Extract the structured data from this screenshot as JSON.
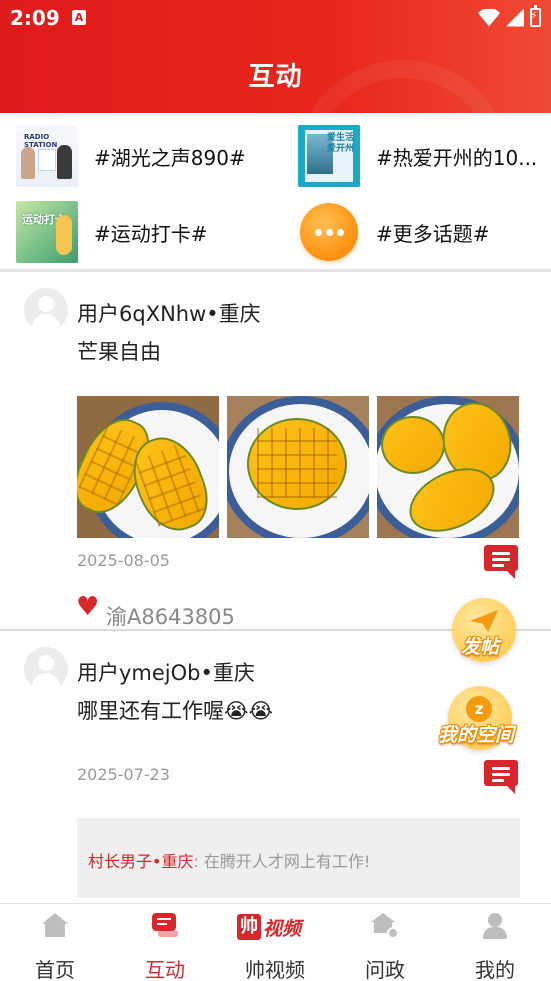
{
  "status_bar": {
    "time": "2:09",
    "notification_icon": "A"
  },
  "header": {
    "title": "互动"
  },
  "topics": [
    {
      "label": "#湖光之声890#",
      "thumb_text": "RADIO STATION"
    },
    {
      "label": "#热爱开州的10...",
      "thumb_text": "爱生活\n爱开州"
    },
    {
      "label": "#运动打卡#",
      "thumb_text": "运动打卡"
    },
    {
      "label": "#更多话题#"
    }
  ],
  "posts": [
    {
      "user": "用户6qXNhw•重庆",
      "text": "芒果自由",
      "date": "2025-08-05",
      "likes": [
        "渝A8643805"
      ]
    },
    {
      "user": "用户ymejOb•重庆",
      "text": "哪里还有工作喔😭😭",
      "date": "2025-07-23",
      "reply": {
        "user": "村长男子•重庆",
        "text": ": 在腾开人才网上有工作!"
      }
    }
  ],
  "floating": {
    "post_label": "发帖",
    "space_label": "我的空间"
  },
  "bottom_nav": {
    "items": [
      {
        "label": "首页",
        "icon": "home-icon"
      },
      {
        "label": "互动",
        "icon": "chat-icon",
        "active": true
      },
      {
        "label": "帅视频",
        "icon": "video-logo",
        "logo_a": "帅",
        "logo_b": "视频"
      },
      {
        "label": "问政",
        "icon": "gov-icon"
      },
      {
        "label": "我的",
        "icon": "profile-icon"
      }
    ]
  },
  "colors": {
    "brand_red": "#e01b1b",
    "accent_orange": "#ff8f10"
  }
}
